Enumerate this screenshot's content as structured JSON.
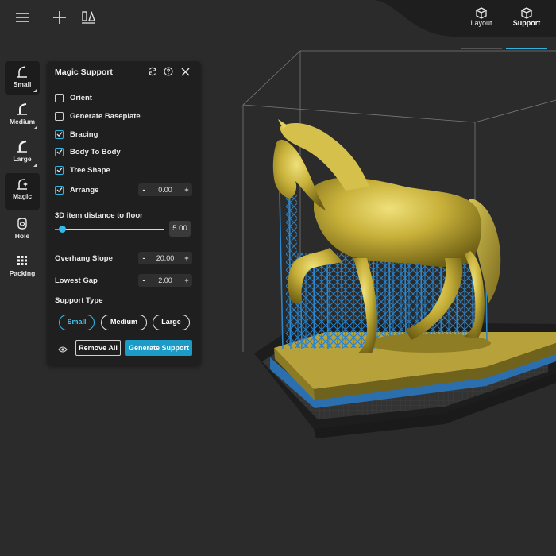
{
  "topbar": {
    "icons": [
      "menu-icon",
      "plus-icon",
      "shapes-icon"
    ],
    "modes": [
      {
        "label": "Layout",
        "icon": "layout-icon",
        "active": false
      },
      {
        "label": "Support",
        "icon": "support-icon",
        "active": true
      }
    ]
  },
  "toolbar": {
    "tools": [
      {
        "label": "Small",
        "icon": "support-small-icon",
        "active": true
      },
      {
        "label": "Medium",
        "icon": "support-medium-icon",
        "active": false
      },
      {
        "label": "Large",
        "icon": "support-large-icon",
        "active": false
      },
      {
        "label": "Magic",
        "icon": "magic-support-icon",
        "active": true
      },
      {
        "label": "Hole",
        "icon": "hole-icon",
        "active": false
      },
      {
        "label": "Packing",
        "icon": "packing-icon",
        "active": false
      }
    ]
  },
  "panel": {
    "title": "Magic Support",
    "options": {
      "orient": {
        "label": "Orient",
        "checked": false
      },
      "baseplate": {
        "label": "Generate Baseplate",
        "checked": false
      },
      "bracing": {
        "label": "Bracing",
        "checked": true
      },
      "body_to_body": {
        "label": "Body To Body",
        "checked": true
      },
      "tree_shape": {
        "label": "Tree Shape",
        "checked": true
      },
      "arrange": {
        "label": "Arrange",
        "checked": true,
        "value": "0.00",
        "minus": "-",
        "plus": "+"
      }
    },
    "distance": {
      "label": "3D item distance to floor",
      "value": "5.00",
      "fraction": 0.07
    },
    "overhang": {
      "label": "Overhang Slope",
      "value": "20.00",
      "minus": "-",
      "plus": "+"
    },
    "lowest_gap": {
      "label": "Lowest Gap",
      "value": "2.00",
      "minus": "-",
      "plus": "+"
    },
    "support_type": {
      "label": "Support Type",
      "options": [
        "Small",
        "Medium",
        "Large"
      ],
      "selected": "Small"
    },
    "remove_all": "Remove All",
    "generate": "Generate Support"
  },
  "colors": {
    "accent": "#2fb3e0",
    "background": "#2b2b2b",
    "panel": "#1f1f1f",
    "model": "#c9b23a",
    "supports": "#2a7fc0"
  }
}
